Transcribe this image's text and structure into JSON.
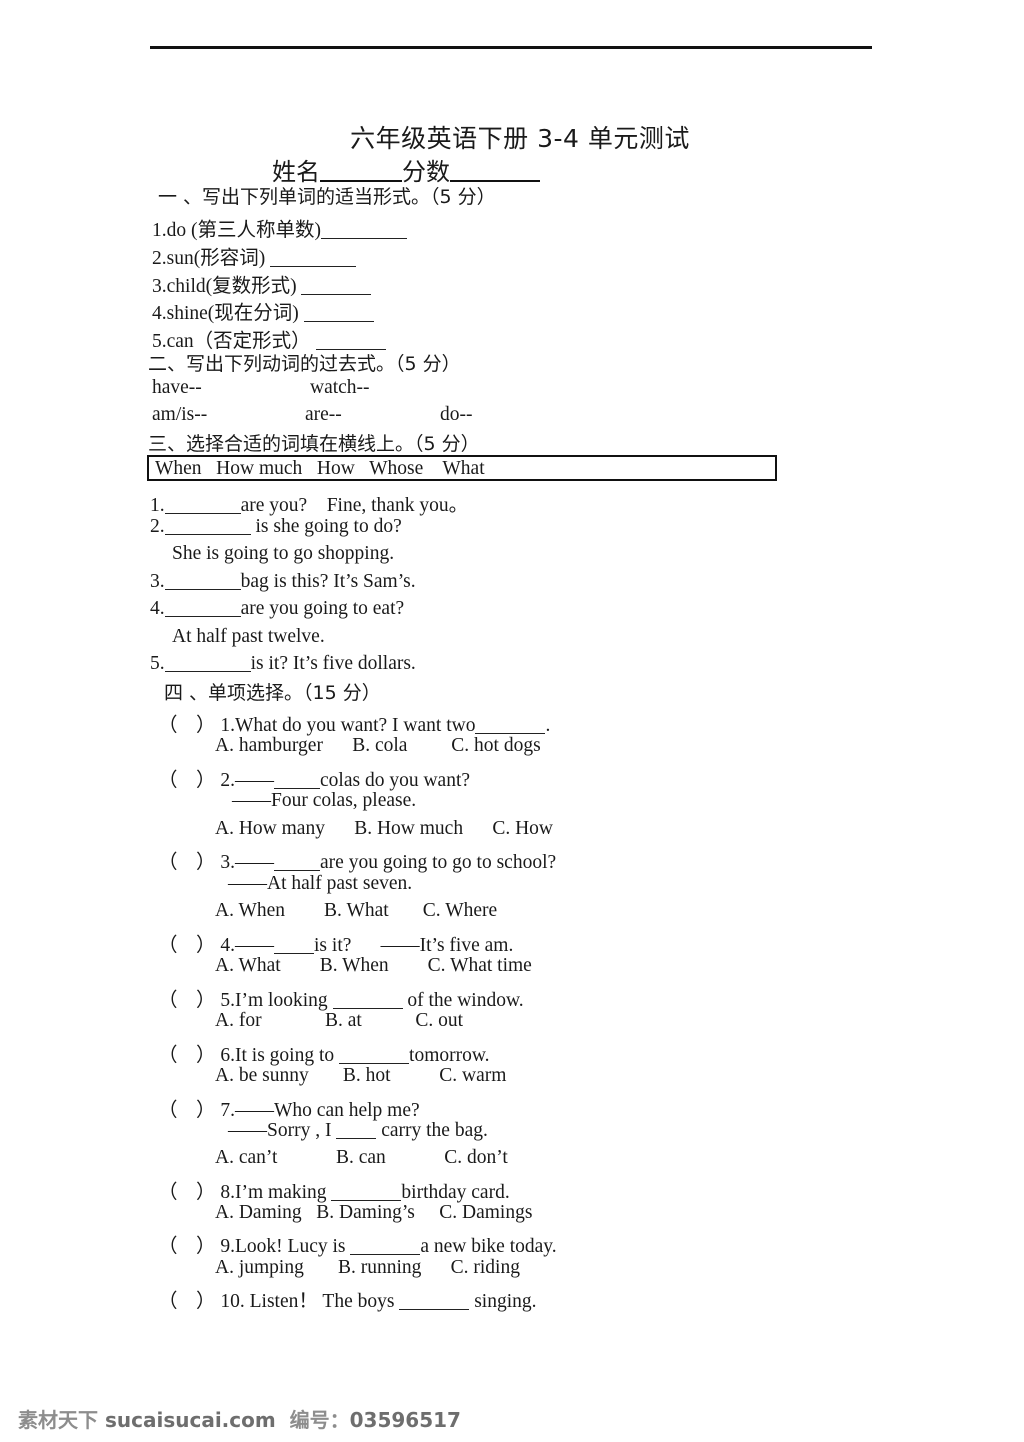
{
  "document": {
    "title": "六年级英语下册 3-4 单元测试",
    "name_score_line": {
      "name_label": "姓名",
      "score_label": "分数"
    }
  },
  "sections": [
    {
      "heading": "一 、写出下列单词的适当形式。（5 分）",
      "items": [
        "1.do (第三人称单数)",
        "2.sun(形容词)",
        "3.child(复数形式)",
        "4.shine(现在分词)",
        "5.can（否定形式）"
      ]
    },
    {
      "heading": "二、写出下列动词的过去式。（5 分）",
      "verbs_row1": [
        "have--",
        "watch--"
      ],
      "verbs_row2": [
        "am/is--",
        "are--",
        "do--"
      ]
    },
    {
      "heading": "三、选择合适的词填在横线上。（5 分）",
      "word_bank": "When   How much   How   Whose    What",
      "blanks": [
        {
          "num": "1.",
          "tail": "are you?    Fine, thank you。"
        },
        {
          "num": "2.",
          "tail": " is she going to do?"
        },
        {
          "continuation": "She is going to go shopping."
        },
        {
          "num": "3.",
          "tail": "bag is this? It’s Sam’s."
        },
        {
          "num": "4.",
          "tail": "are you going to eat?"
        },
        {
          "continuation": "At half past twelve."
        },
        {
          "num": "5.",
          "tail": "is it? It’s five dollars."
        }
      ]
    },
    {
      "heading": "四 、单项选择。（15 分）",
      "questions": [
        {
          "paren_open": "（",
          "paren_close": "）",
          "stem_pre": "1.What do you want? I want two",
          "stem_post": ".",
          "options": "A. hamburger      B. cola         C. hot dogs"
        },
        {
          "paren_open": "（",
          "paren_close": "）",
          "stem_pre": "2.——",
          "stem_post": "colas do you want?",
          "continuation": "——Four colas, please.",
          "options": "A. How many      B. How much      C. How"
        },
        {
          "paren_open": "（",
          "paren_close": "）",
          "stem_pre": "3.——",
          "stem_post": "are you going to go to school?",
          "continuation": "——At half past seven.",
          "options": "A. When        B. What       C. Where"
        },
        {
          "paren_open": "（",
          "paren_close": "）",
          "stem_pre": "4.——",
          "stem_post": "is it?      ——It’s five am.",
          "options": "A. What        B. When        C. What time"
        },
        {
          "paren_open": "（",
          "paren_close": "）",
          "stem_pre": "5.I’m looking ",
          "stem_post": " of the window.",
          "options": "A. for             B. at           C. out"
        },
        {
          "paren_open": "（",
          "paren_close": "）",
          "stem_pre": "6.It is going to ",
          "stem_post": "tomorrow.",
          "options": "A. be sunny       B. hot          C. warm"
        },
        {
          "paren_open": "（",
          "paren_close": "）",
          "stem_pre": "7.——Who can help me?",
          "stem_post": "",
          "continuation_pre": "——Sorry , I ",
          "continuation_post": " carry the bag.",
          "options": "A. can’t            B. can            C. don’t"
        },
        {
          "paren_open": "（",
          "paren_close": "）",
          "stem_pre": "8.I’m making ",
          "stem_post": "birthday card.",
          "options": "A. Daming   B. Daming’s     C. Damings"
        },
        {
          "paren_open": "（",
          "paren_close": "）",
          "stem_pre": "9.Look! Lucy is ",
          "stem_post": "a new bike today.",
          "options": "A. jumping       B. running      C. riding"
        },
        {
          "paren_open": "（",
          "paren_close": "）",
          "stem_pre": "10. Listen！ The boys ",
          "stem_post": " singing.",
          "options": ""
        }
      ]
    }
  ],
  "footer": {
    "site_label": "素材天下",
    "site_url": "sucaisucai.com",
    "id_label": "编号：",
    "id_value": "03596517"
  }
}
